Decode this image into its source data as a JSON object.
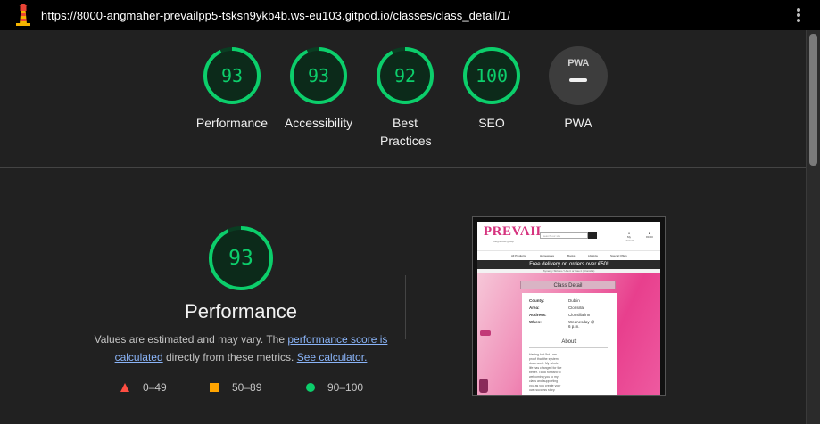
{
  "browser": {
    "url": "https://8000-angmaher-prevailpp5-tsksn9ykb4b.ws-eu103.gitpod.io/classes/class_detail/1/"
  },
  "colors": {
    "pass": "#0cce6b",
    "average": "#ffa400",
    "fail": "#ff4e42",
    "link": "#8ab4f8"
  },
  "summary": [
    {
      "id": "performance",
      "score": "93",
      "label": "Performance",
      "value": 93
    },
    {
      "id": "accessibility",
      "score": "93",
      "label": "Accessibility",
      "value": 93
    },
    {
      "id": "best-practices",
      "score": "92",
      "label": "Best Practices",
      "value": 92
    },
    {
      "id": "seo",
      "score": "100",
      "label": "SEO",
      "value": 100
    },
    {
      "id": "pwa",
      "badge": "PWA",
      "label": "PWA"
    }
  ],
  "performance": {
    "score": "93",
    "value": 93,
    "title": "Performance",
    "note_prefix": "Values are estimated and may vary. The ",
    "link1": "performance score is calculated",
    "note_middle": " directly from these metrics. ",
    "link2": "See calculator."
  },
  "legend": [
    {
      "shape": "triangle",
      "range": "0–49"
    },
    {
      "shape": "square",
      "range": "50–89"
    },
    {
      "shape": "circle",
      "range": "90–100"
    }
  ],
  "screenshot": {
    "brand": "PREVAIL",
    "brand_sub": "Weight loss group",
    "search_placeholder": "Search our site",
    "my_account": "My Account",
    "cart_total": "€0.00",
    "nav": [
      "All Products",
      "Homewares",
      "Books",
      "Lifestyle",
      "Special Offers"
    ],
    "banner": "Free delivery on orders over €50!",
    "banner_sub": "Synergy Strides / Use it or lose it (Clonsilla)",
    "card_title": "Class Detail",
    "fields": [
      {
        "label": "County:",
        "value": "Dublin"
      },
      {
        "label": "Area:",
        "value": "Clonsilla"
      },
      {
        "label": "Address:",
        "value": "Clonsilla.lnn"
      },
      {
        "label": "When:",
        "value": "Wednesday @ 6 p.m."
      }
    ],
    "about_title": "About:",
    "about_text": "Having lost 5st I am proof that the system does work. My whole life has changed for the better. I look forward to welcoming you to my class and supporting you as you create your own success story."
  }
}
